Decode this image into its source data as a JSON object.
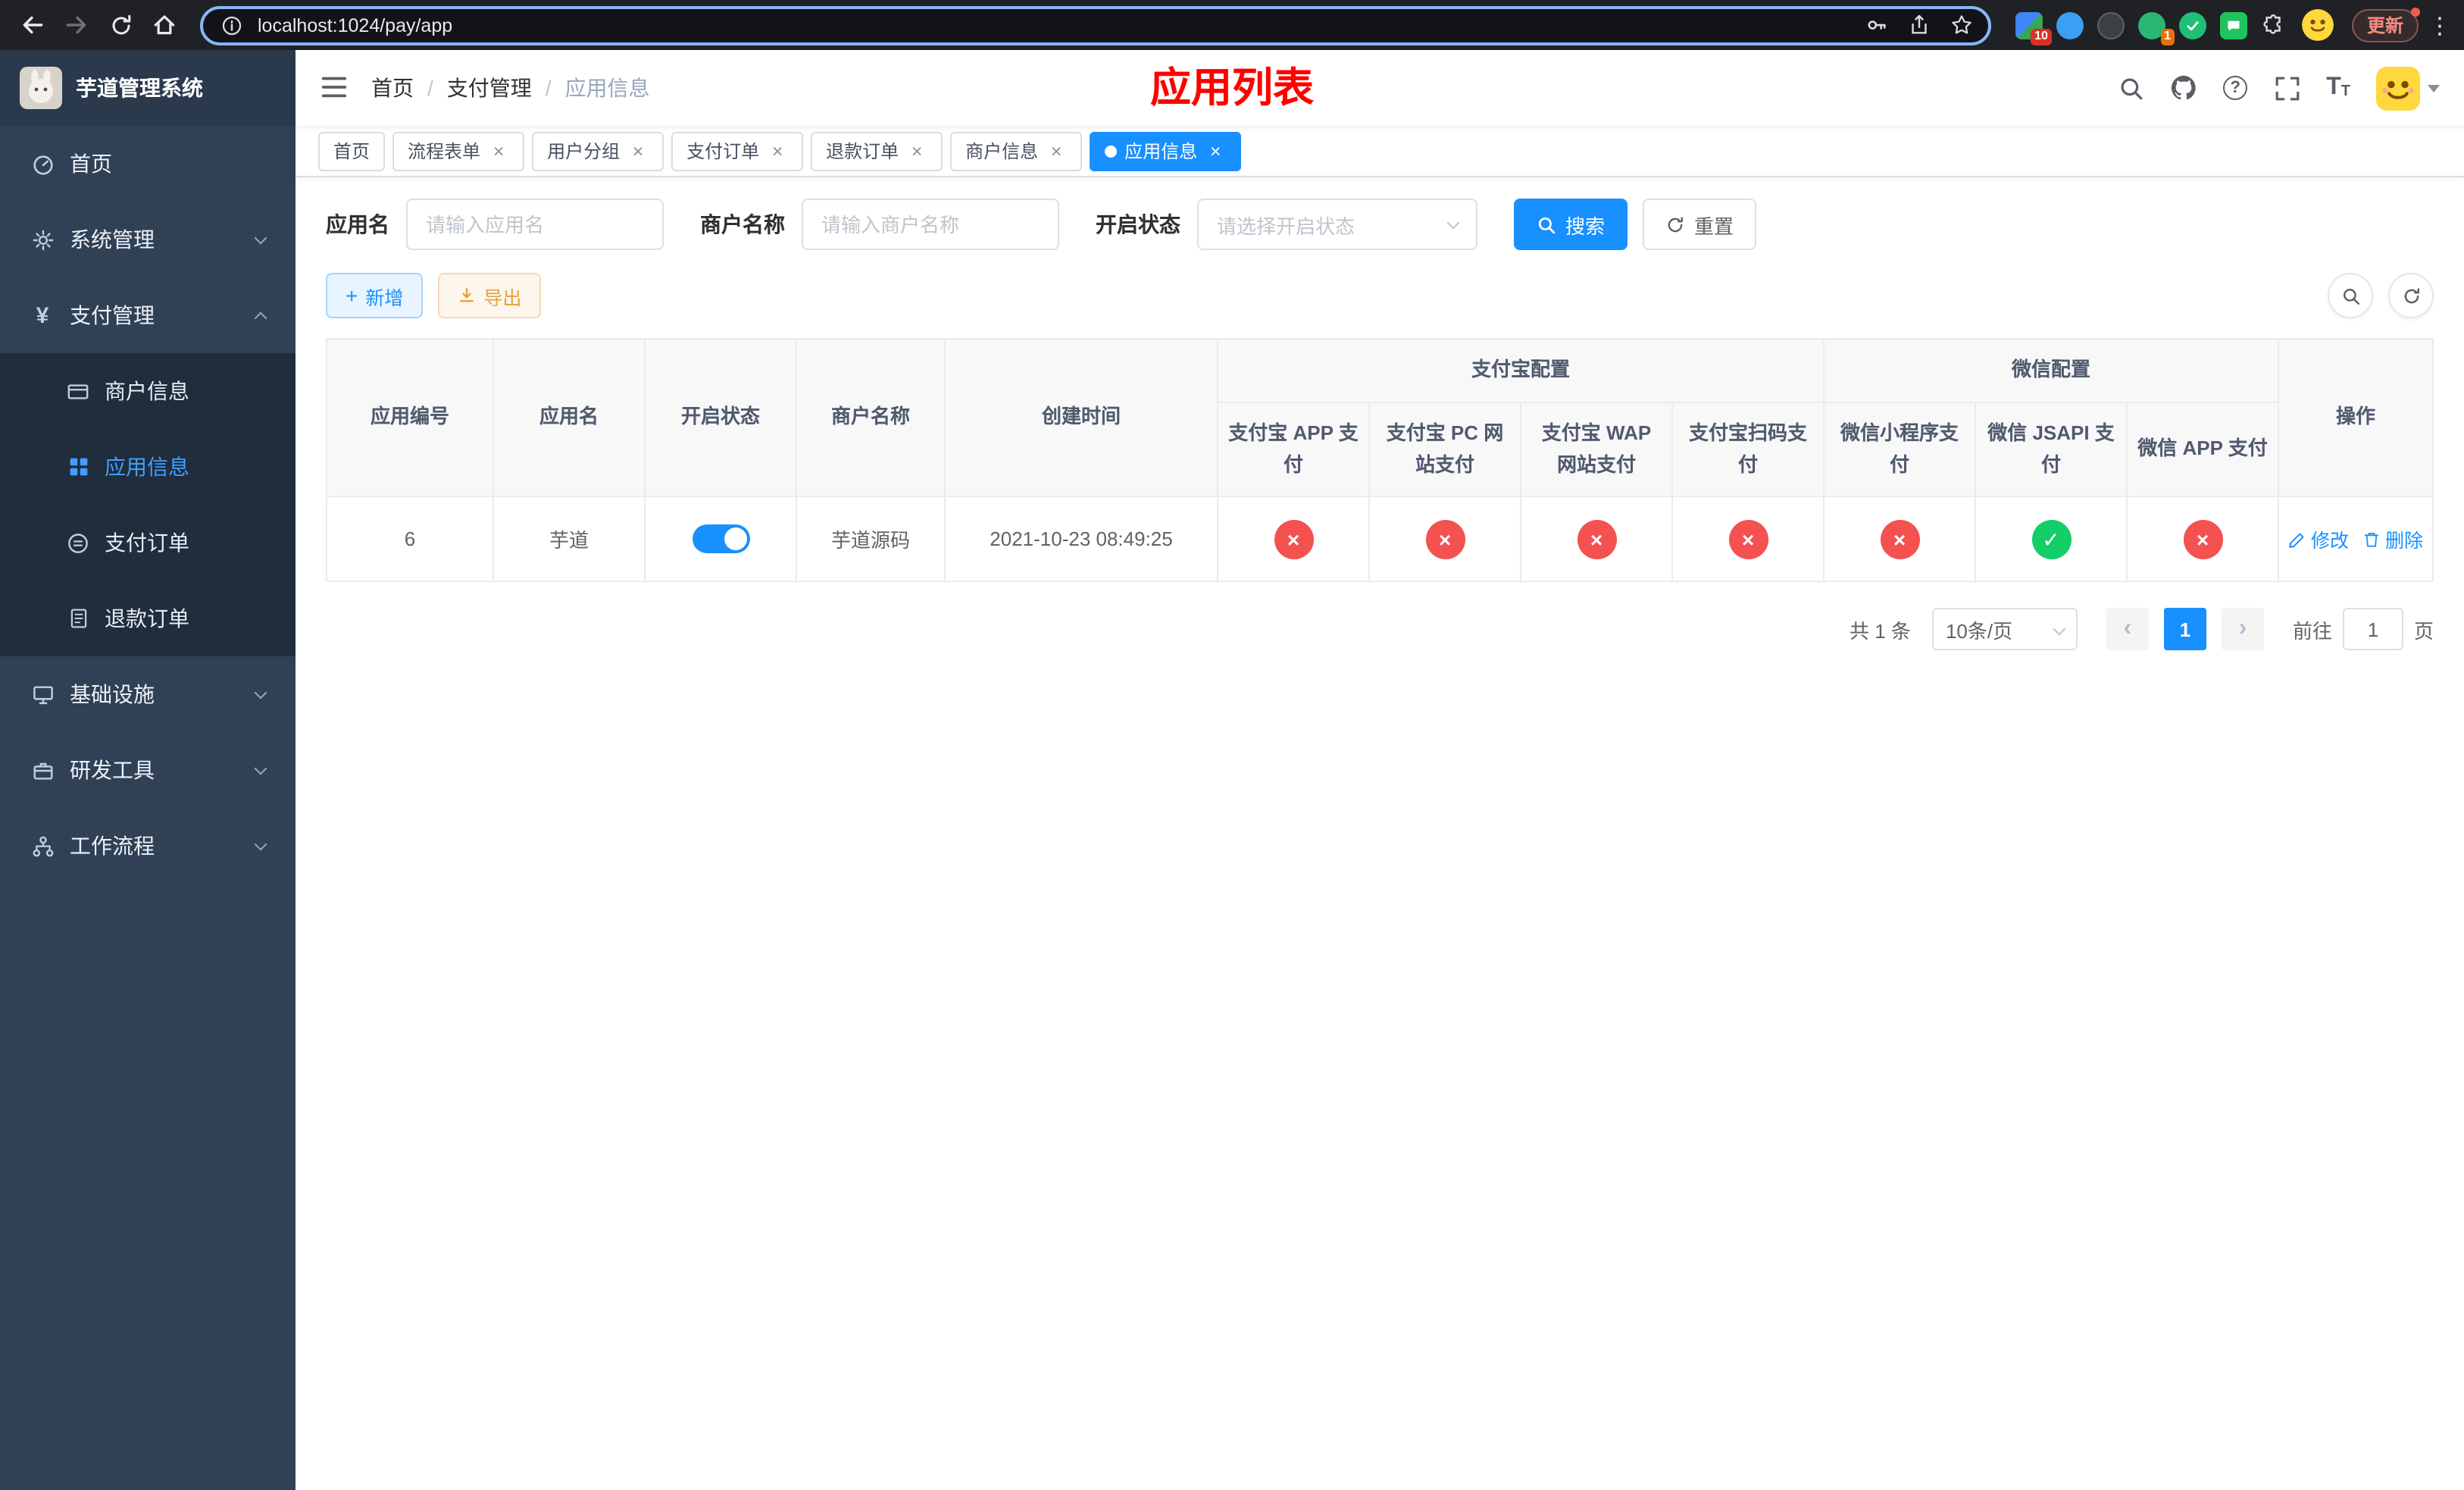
{
  "colors": {
    "primary": "#1890ff",
    "sidebar_active": "#409eff",
    "success": "#13ce66",
    "danger": "#f45151",
    "page_title_red": "#ff0000"
  },
  "icons": {
    "close": "×",
    "plus": "+",
    "check": "✓",
    "cross": "×",
    "prev": "‹",
    "next": "›",
    "question": "?",
    "kebab": "⋮",
    "yen": "¥",
    "font_large": "T",
    "font_small": "T"
  },
  "browser": {
    "url": "localhost:1024/pay/app",
    "update_label": "更新",
    "ext_badge_10": "10",
    "ext_badge_1": "1"
  },
  "sidebar": {
    "title": "芋道管理系统",
    "menu_home": "首页",
    "menu_system": "系统管理",
    "menu_pay": "支付管理",
    "menu_infra": "基础设施",
    "menu_dev": "研发工具",
    "menu_flow": "工作流程",
    "sub_merchant": "商户信息",
    "sub_app": "应用信息",
    "sub_order": "支付订单",
    "sub_refund": "退款订单"
  },
  "navbar": {
    "breadcrumb": [
      "首页",
      "支付管理",
      "应用信息"
    ],
    "crumb_sep": "/",
    "page_title": "应用列表"
  },
  "tabs": [
    {
      "label": "首页"
    },
    {
      "label": "流程表单"
    },
    {
      "label": "用户分组"
    },
    {
      "label": "支付订单"
    },
    {
      "label": "退款订单"
    },
    {
      "label": "商户信息"
    },
    {
      "label": "应用信息"
    }
  ],
  "filters": {
    "app_name_label": "应用名",
    "app_name_placeholder": "请输入应用名",
    "merchant_label": "商户名称",
    "merchant_placeholder": "请输入商户名称",
    "status_label": "开启状态",
    "status_placeholder": "请选择开启状态",
    "search_label": "搜索",
    "reset_label": "重置"
  },
  "toolbar": {
    "add_label": "新增",
    "export_label": "导出"
  },
  "table": {
    "headers": {
      "app_id": "应用编号",
      "app_name": "应用名",
      "status": "开启状态",
      "merchant": "商户名称",
      "created": "创建时间",
      "alipay_group": "支付宝配置",
      "wechat_group": "微信配置",
      "actions": "操作",
      "sub": [
        "支付宝 APP 支付",
        "支付宝 PC 网站支付",
        "支付宝 WAP 网站支付",
        "支付宝扫码支付",
        "微信小程序支付",
        "微信 JSAPI 支付",
        "微信 APP 支付"
      ]
    },
    "rows": [
      {
        "app_id": "6",
        "app_name": "芋道",
        "status_on": true,
        "merchant": "芋道源码",
        "created": "2021-10-23 08:49:25",
        "configs": [
          {
            "name": "alipay-app-pay",
            "enabled": false
          },
          {
            "name": "alipay-pc-pay",
            "enabled": false
          },
          {
            "name": "alipay-wap-pay",
            "enabled": false
          },
          {
            "name": "alipay-qr-pay",
            "enabled": false
          },
          {
            "name": "wechat-mini-pay",
            "enabled": false
          },
          {
            "name": "wechat-jsapi-pay",
            "enabled": true
          },
          {
            "name": "wechat-app-pay",
            "enabled": false
          }
        ],
        "edit_label": "修改",
        "delete_label": "删除"
      }
    ]
  },
  "pagination": {
    "total": "共 1 条",
    "page_size": "10条/页",
    "current": "1",
    "goto_prefix": "前往",
    "goto_value": "1",
    "goto_suffix": "页"
  }
}
